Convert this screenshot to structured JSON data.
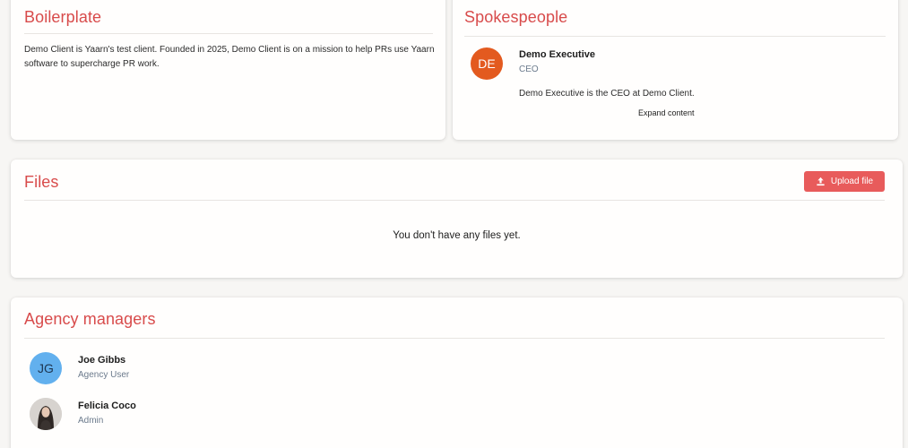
{
  "boilerplate": {
    "title": "Boilerplate",
    "text": "Demo Client is Yaarn's test client. Founded in 2025, Demo Client is on a mission to help PRs use Yaarn software to supercharge PR work."
  },
  "spokespeople": {
    "title": "Spokespeople",
    "people": [
      {
        "initials": "DE",
        "name": "Demo Executive",
        "role": "CEO",
        "bio": "Demo Executive is the CEO at Demo Client.",
        "expand_label": "Expand content",
        "avatar_color": "#e35a1f"
      }
    ]
  },
  "files": {
    "title": "Files",
    "upload_label": "Upload file",
    "empty_text": "You don't have any files yet."
  },
  "agency_managers": {
    "title": "Agency managers",
    "managers": [
      {
        "initials": "JG",
        "name": "Joe Gibbs",
        "role": "Agency User",
        "avatar_color": "#62b0ee"
      },
      {
        "initials": "",
        "name": "Felicia Coco",
        "role": "Admin",
        "avatar": "photo"
      }
    ]
  },
  "colors": {
    "accent": "#d84b4b",
    "button": "#e85b5b"
  }
}
